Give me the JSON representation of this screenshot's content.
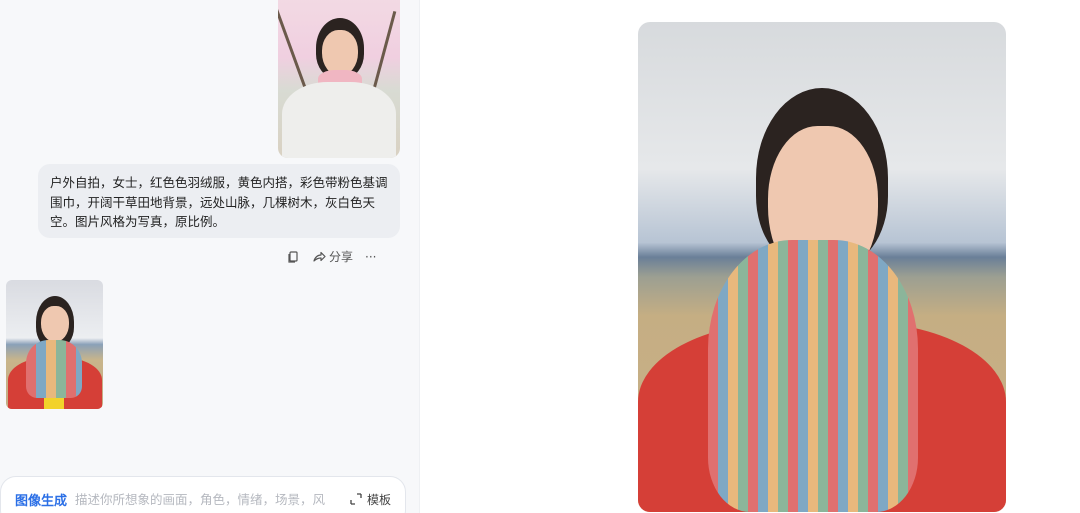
{
  "conversation": {
    "prompt_text": "户外自拍，女士，红色色羽绒服，黄色内搭，彩色带粉色基调围巾，开阔干草田地背景，远处山脉，几棵树木，灰白色天空。图片风格为写真，原比例。",
    "actions": {
      "copy_icon": "copy-icon",
      "share_label": "分享",
      "more_label": "···"
    }
  },
  "input_bar": {
    "mode_label": "图像生成",
    "placeholder": "描述你所想象的画面，角色，情绪，场景，风",
    "template_label": "模板"
  },
  "colors": {
    "accent": "#2b6fe6",
    "panel": "#f7f8fa",
    "bubble": "#eceef2"
  }
}
